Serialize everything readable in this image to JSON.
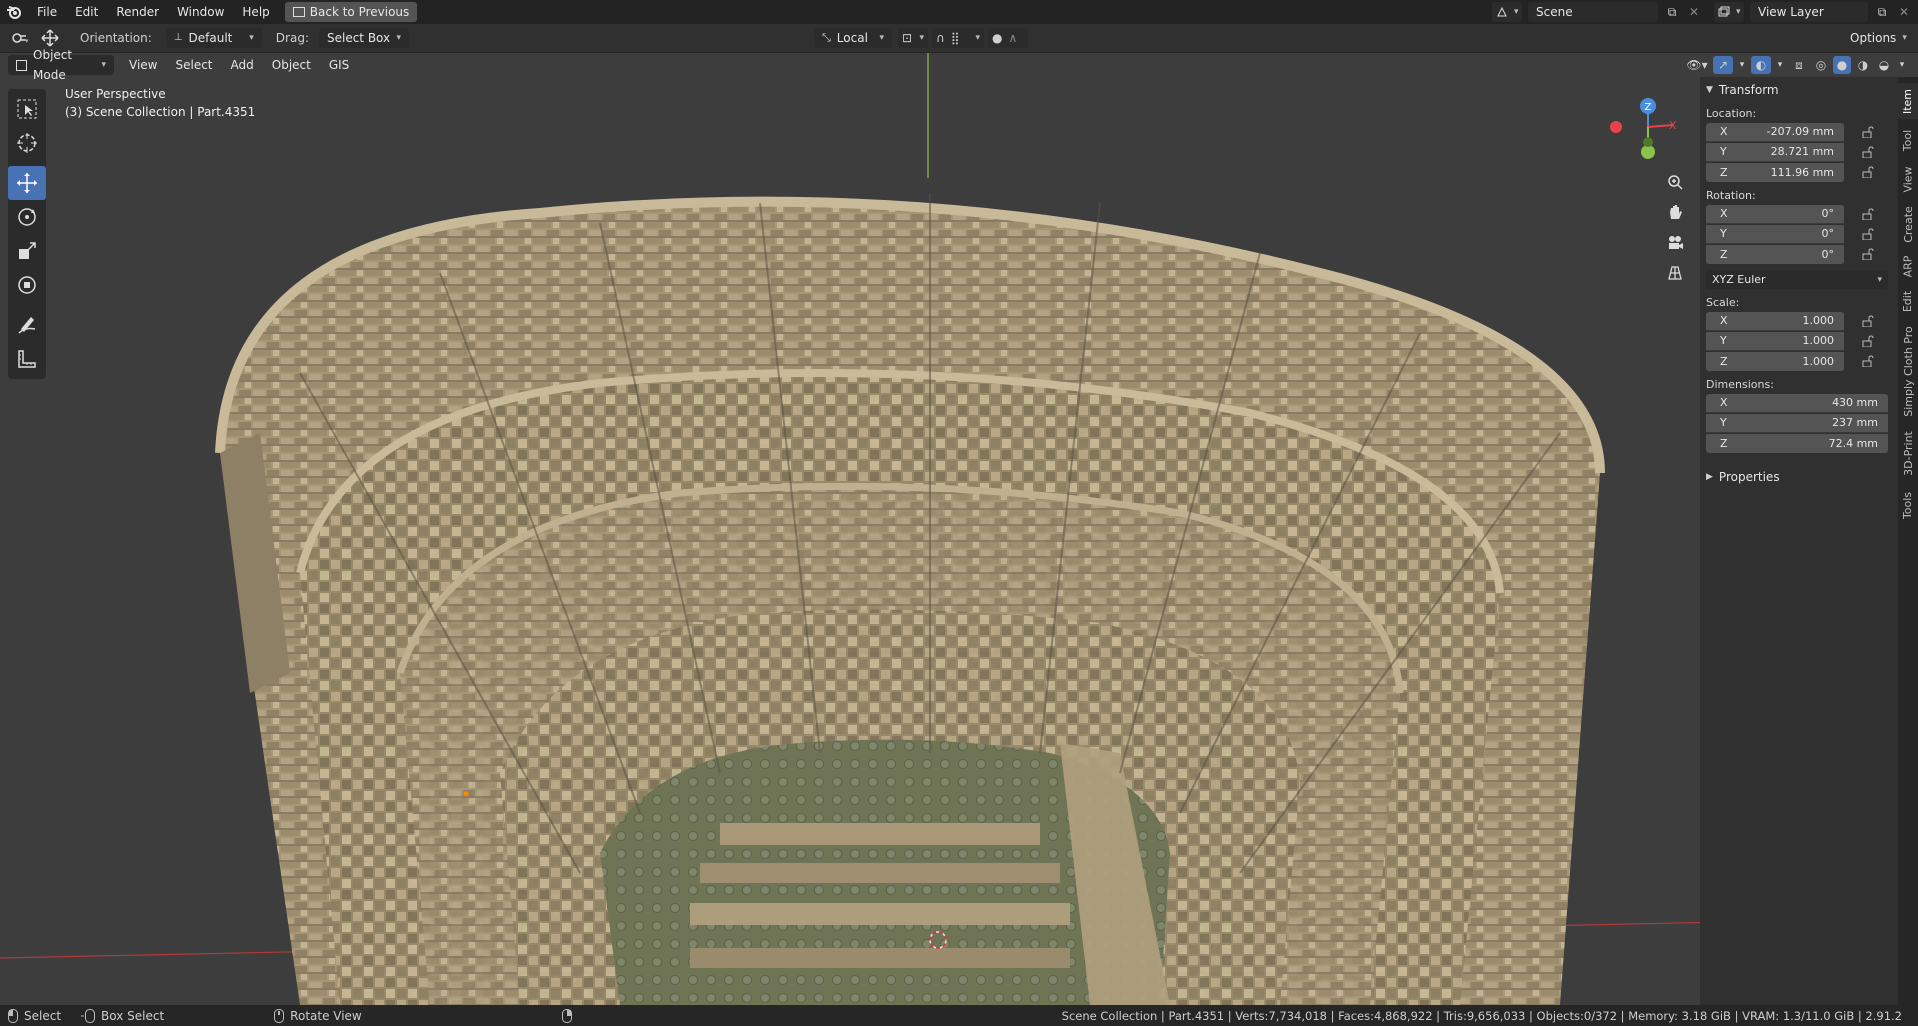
{
  "topbar": {
    "menus": [
      "File",
      "Edit",
      "Render",
      "Window",
      "Help"
    ],
    "back_button": "Back to Previous",
    "scene_name": "Scene",
    "view_layer": "View Layer"
  },
  "toolheader": {
    "orientation_label": "Orientation:",
    "orientation_value": "Default",
    "drag_label": "Drag:",
    "drag_value": "Select Box",
    "transform_orientation": "Local",
    "options_label": "Options"
  },
  "viewheader": {
    "mode": "Object Mode",
    "menus": [
      "View",
      "Select",
      "Add",
      "Object",
      "GIS"
    ]
  },
  "viewport": {
    "perspective": "User Perspective",
    "collection": "(3) Scene Collection | Part.4351",
    "gizmo_axes": [
      "X",
      "Y",
      "Z"
    ]
  },
  "npanel": {
    "transform_title": "Transform",
    "location_label": "Location:",
    "location": [
      {
        "axis": "X",
        "value": "-207.09 mm"
      },
      {
        "axis": "Y",
        "value": "28.721 mm"
      },
      {
        "axis": "Z",
        "value": "111.96 mm"
      }
    ],
    "rotation_label": "Rotation:",
    "rotation": [
      {
        "axis": "X",
        "value": "0°"
      },
      {
        "axis": "Y",
        "value": "0°"
      },
      {
        "axis": "Z",
        "value": "0°"
      }
    ],
    "rotation_mode": "XYZ Euler",
    "scale_label": "Scale:",
    "scale": [
      {
        "axis": "X",
        "value": "1.000"
      },
      {
        "axis": "Y",
        "value": "1.000"
      },
      {
        "axis": "Z",
        "value": "1.000"
      }
    ],
    "dimensions_label": "Dimensions:",
    "dimensions": [
      {
        "axis": "X",
        "value": "430 mm"
      },
      {
        "axis": "Y",
        "value": "237 mm"
      },
      {
        "axis": "Z",
        "value": "72.4 mm"
      }
    ],
    "properties_title": "Properties",
    "tabs": [
      "Item",
      "Tool",
      "View",
      "Create",
      "ARP",
      "Edit",
      "Simply Cloth Pro",
      "3D-Print",
      "Tools"
    ]
  },
  "statusbar": {
    "select": "Select",
    "box_select": "Box Select",
    "rotate_view": "Rotate View",
    "stats": "Scene Collection | Part.4351 | Verts:7,734,018 | Faces:4,868,922 | Tris:9,656,033 | Objects:0/372 | Memory: 3.18 GiB | VRAM: 1.3/11.0 GiB | 2.91.2"
  },
  "colors": {
    "accent": "#4772b3",
    "stone": "#a39474",
    "stone_dark": "#6e6350",
    "grass": "#75795a",
    "x_axis": "#e8424e",
    "y_axis": "#8bc34a",
    "z_axis": "#4a8ee0"
  }
}
